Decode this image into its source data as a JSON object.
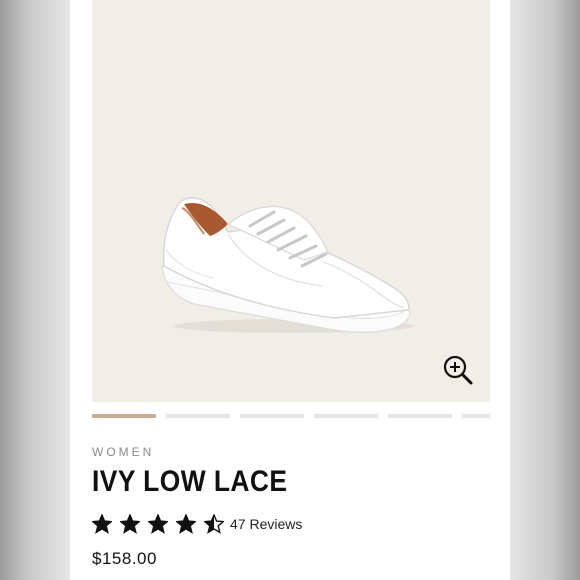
{
  "product": {
    "category": "WOMEN",
    "name": "IVY LOW LACE",
    "rating": 4.5,
    "rating_max": 5,
    "reviews_label": "47 Reviews",
    "price": "$158.00"
  },
  "gallery": {
    "image_count": 6,
    "active_index": 0,
    "zoom_icon": "zoom-in-icon"
  },
  "colors": {
    "hero_background": "#f1eee7",
    "active_indicator": "#c9ab8f",
    "inactive_indicator": "#e5e5e5"
  }
}
